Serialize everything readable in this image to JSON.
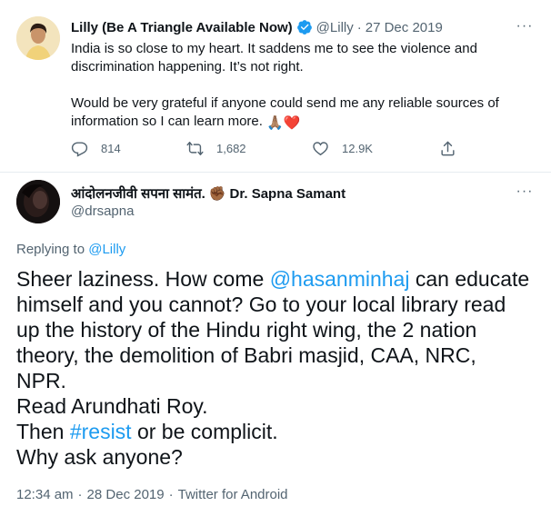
{
  "tweet": {
    "author_name": "Lilly (Be A Triangle Available Now)",
    "author_handle": "@Lilly",
    "separator": "·",
    "date": "27 Dec 2019",
    "paragraph_1": "India is so close to my heart. It saddens me to see the violence and discrimination happening. It’s not right.",
    "paragraph_2_text": "Would be very grateful if anyone could send me any reliable sources of information so I can learn more. ",
    "paragraph_2_emoji_1": "🙏🏽",
    "paragraph_2_emoji_2": "❤️",
    "more_label": "···",
    "stats": {
      "replies": "814",
      "retweets": "1,682",
      "likes": "12.9K"
    }
  },
  "reply": {
    "author_name_hindi": "आंदोलनजीवी सपना सामंत.",
    "author_fist_emoji": "✊🏾",
    "author_name_english": "Dr. Sapna Samant",
    "author_handle": "@drsapna",
    "more_label": "···",
    "replying_to_prefix": "Replying to ",
    "replying_to_handle": "@Lilly",
    "body": {
      "l1_a": "Sheer laziness. How come ",
      "l1_mention": "@hasanminhaj",
      "l1_b": " can educate",
      "l2": "himself and you cannot? Go to your local library read",
      "l3": "up the history of the Hindu right wing, the 2 nation",
      "l4": "theory, the demolition of Babri masjid, CAA, NRC,",
      "l5": "NPR.",
      "l6": "Read Arundhati Roy.",
      "l7_a": "Then ",
      "l7_hashtag": "#resist",
      "l7_b": " or be complicit.",
      "l8": "Why ask anyone?"
    },
    "footer": {
      "time": "12:34 am",
      "dot1": "·",
      "date": "28 Dec 2019",
      "dot2": "·",
      "client": "Twitter for Android"
    }
  },
  "colors": {
    "link": "#1d9bf0",
    "verified": "#1d9bf0",
    "muted_text": "#536471",
    "heart": "#e0245e"
  },
  "icons": [
    "verified-badge-icon",
    "more-icon",
    "reply-icon",
    "retweet-icon",
    "like-icon",
    "share-icon"
  ]
}
